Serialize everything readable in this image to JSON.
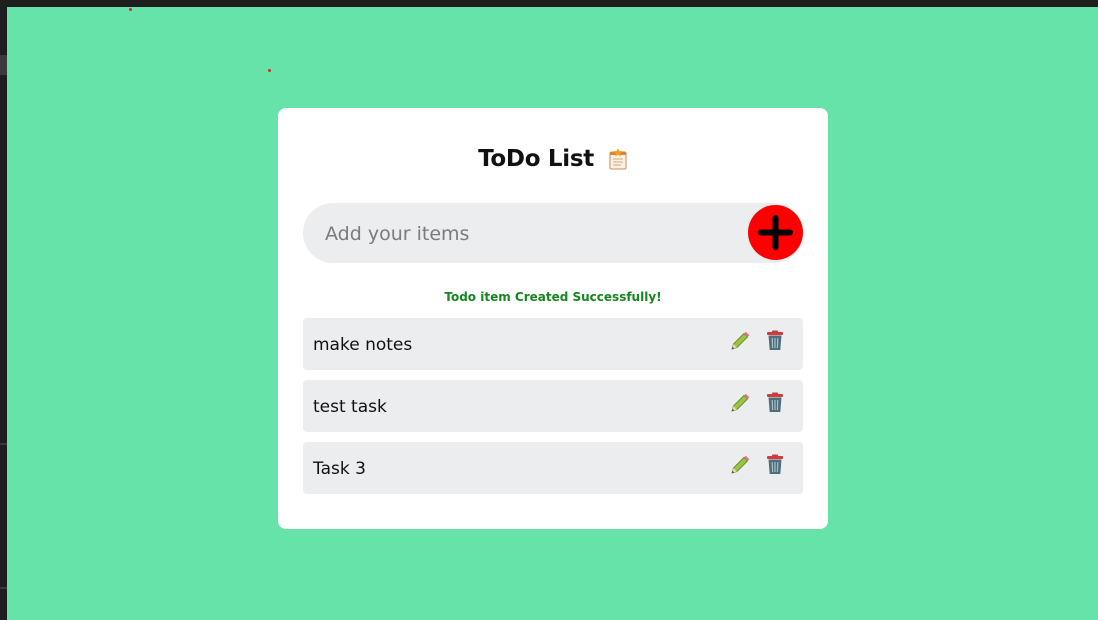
{
  "app": {
    "title": "ToDo List",
    "title_icon": "notepad-icon"
  },
  "add_item": {
    "placeholder": "Add your items",
    "value": "",
    "button_icon": "plus-icon"
  },
  "status_message": "Todo item Created Successfully!",
  "todos": [
    {
      "text": "make notes"
    },
    {
      "text": "test task"
    },
    {
      "text": "Task 3"
    }
  ],
  "item_actions": {
    "edit_icon": "pencil-icon",
    "delete_icon": "trash-icon"
  },
  "colors": {
    "background": "#66e3a8",
    "card": "#ffffff",
    "add_button": "#ff0000",
    "status_text": "#14881f",
    "item_background": "#ecedef"
  }
}
